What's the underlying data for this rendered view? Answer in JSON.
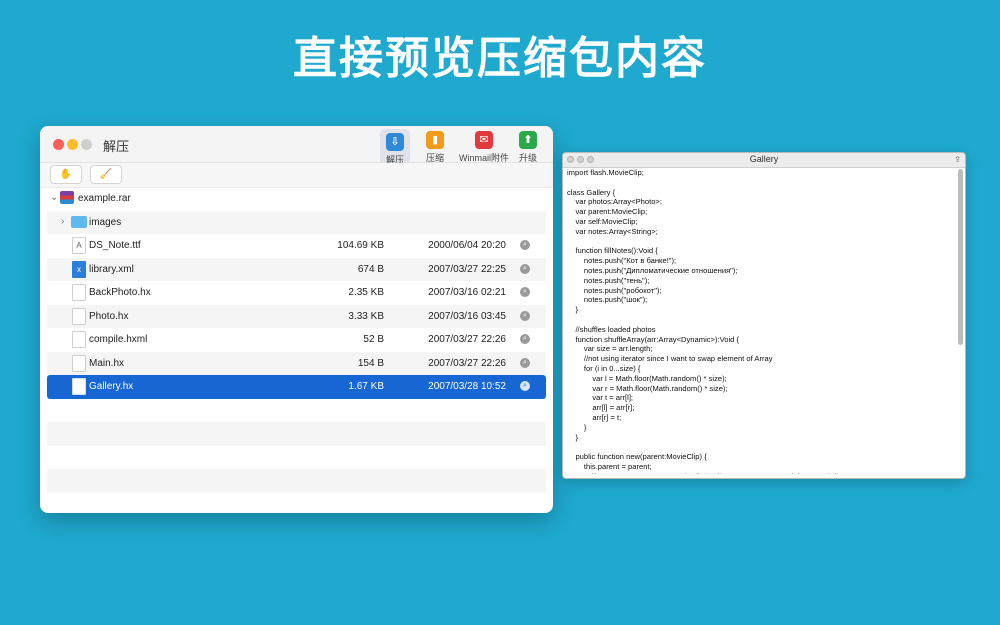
{
  "headline": "直接预览压缩包内容",
  "main_window": {
    "title": "解压",
    "toolbar": [
      {
        "label": "解压",
        "icon": "unzip-icon",
        "color": "#2f88d8"
      },
      {
        "label": "压缩",
        "icon": "compress-icon",
        "color": "#f39a1a"
      },
      {
        "label": "Winmail附件",
        "icon": "winmail-icon",
        "color": "#e03a3a"
      },
      {
        "label": "升级",
        "icon": "upgrade-icon",
        "color": "#2aa84a"
      }
    ],
    "archive": {
      "name": "example.rar"
    },
    "folder": {
      "name": "images"
    },
    "files": [
      {
        "name": "DS_Note.ttf",
        "size": "104.69 KB",
        "date": "2000/06/04 20:20",
        "selected": false
      },
      {
        "name": "library.xml",
        "size": "674 B",
        "date": "2007/03/27 22:25",
        "selected": false
      },
      {
        "name": "BackPhoto.hx",
        "size": "2.35 KB",
        "date": "2007/03/16 02:21",
        "selected": false
      },
      {
        "name": "Photo.hx",
        "size": "3.33 KB",
        "date": "2007/03/16 03:45",
        "selected": false
      },
      {
        "name": "compile.hxml",
        "size": "52 B",
        "date": "2007/03/27 22:26",
        "selected": false
      },
      {
        "name": "Main.hx",
        "size": "154 B",
        "date": "2007/03/27 22:26",
        "selected": false
      },
      {
        "name": "Gallery.hx",
        "size": "1.67 KB",
        "date": "2007/03/28 10:52",
        "selected": true
      }
    ]
  },
  "viewer": {
    "title": "Gallery",
    "code_lines": [
      "import flash.MovieClip;",
      "",
      "class Gallery {",
      "    var photos:Array<Photo>;",
      "    var parent:MovieClip;",
      "    var self:MovieClip;",
      "    var notes:Array<String>;",
      "",
      "    function fillNotes():Void {",
      "        notes.push(\"Кот в банке!\");",
      "        notes.push(\"Дипломатические отношения\");",
      "        notes.push(\"тень\");",
      "        notes.push(\"робокот\");",
      "        notes.push(\"шок\");",
      "    }",
      "",
      "    //shuffles loaded photos",
      "    function shuffleArray(arr:Array<Dynamic>):Void {",
      "        var size = arr.length;",
      "        //not using iterator since I want to swap element of Array",
      "        for (i in 0...size) {",
      "            var l = Math.floor(Math.random() * size);",
      "            var r = Math.floor(Math.random() * size);",
      "            var t = arr[l];",
      "            arr[l] = arr[r];",
      "            arr[r] = t;",
      "        }",
      "    }",
      "",
      "    public function new(parent:MovieClip) {",
      "        this.parent = parent;",
      "        self = parent.createEmptyMovieClip(\"gallery\",parent.getNextHighestDepth());"
    ]
  }
}
